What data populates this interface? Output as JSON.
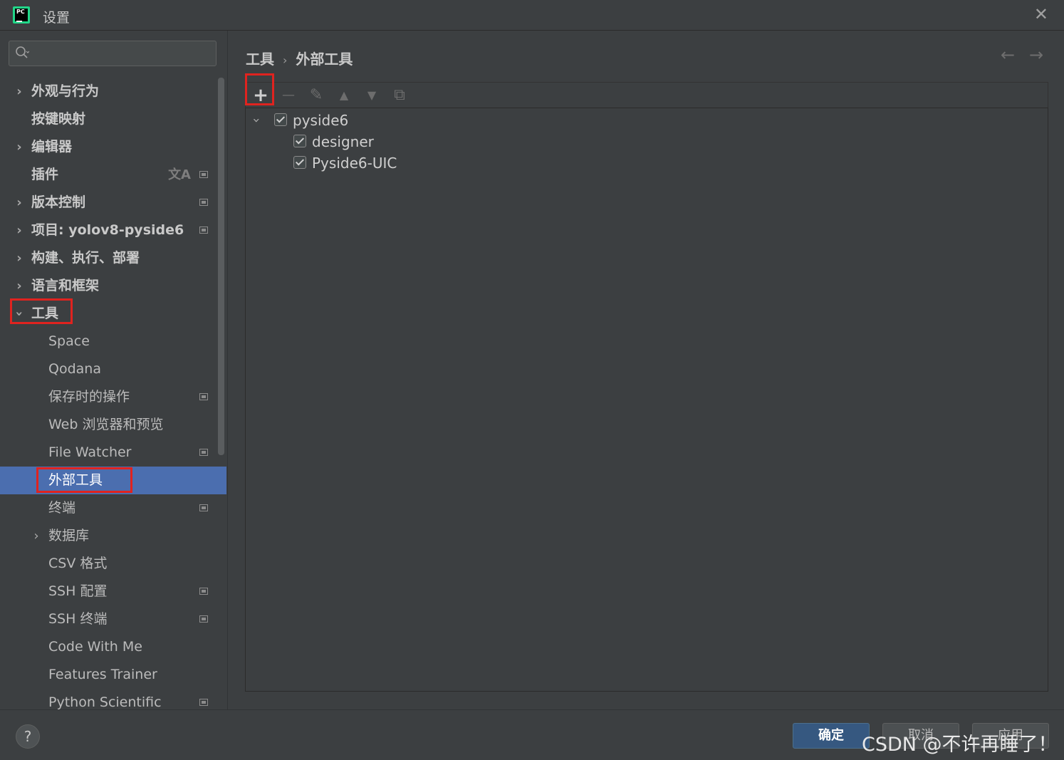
{
  "window": {
    "title": "设置",
    "app_icon": "pycharm-icon",
    "close_icon": "close-icon"
  },
  "search": {
    "placeholder": "",
    "icon": "search-icon"
  },
  "sidebar": {
    "items": [
      {
        "label": "外观与行为",
        "expandable": true,
        "bold": true,
        "expanded": false
      },
      {
        "label": "按键映射",
        "expandable": false,
        "bold": true
      },
      {
        "label": "编辑器",
        "expandable": true,
        "bold": true,
        "expanded": false
      },
      {
        "label": "插件",
        "expandable": false,
        "bold": true,
        "icons": [
          "translate-icon",
          "project-icon"
        ]
      },
      {
        "label": "版本控制",
        "expandable": true,
        "bold": true,
        "expanded": false,
        "icons": [
          "project-icon"
        ]
      },
      {
        "label": "项目: yolov8-pyside6",
        "expandable": true,
        "bold": true,
        "expanded": false,
        "icons": [
          "project-icon"
        ]
      },
      {
        "label": "构建、执行、部署",
        "expandable": true,
        "bold": true,
        "expanded": false
      },
      {
        "label": "语言和框架",
        "expandable": true,
        "bold": true,
        "expanded": false
      },
      {
        "label": "工具",
        "expandable": true,
        "bold": true,
        "expanded": true
      },
      {
        "label": "Space"
      },
      {
        "label": "Qodana"
      },
      {
        "label": "保存时的操作",
        "icons": [
          "project-icon"
        ]
      },
      {
        "label": "Web 浏览器和预览"
      },
      {
        "label": "File Watcher",
        "icons": [
          "project-icon"
        ]
      },
      {
        "label": "外部工具",
        "selected": true
      },
      {
        "label": "终端",
        "icons": [
          "project-icon"
        ]
      },
      {
        "label": "数据库",
        "expandable": true,
        "expanded": false
      },
      {
        "label": "CSV 格式"
      },
      {
        "label": "SSH 配置",
        "icons": [
          "project-icon"
        ]
      },
      {
        "label": "SSH 终端",
        "icons": [
          "project-icon"
        ]
      },
      {
        "label": "Code With Me"
      },
      {
        "label": "Features Trainer"
      },
      {
        "label": "Python Scientific",
        "icons": [
          "project-icon"
        ]
      }
    ]
  },
  "breadcrumb": {
    "parent": "工具",
    "separator": "›",
    "current": "外部工具"
  },
  "toolbar": {
    "add": "+",
    "remove": "—",
    "edit": "✎",
    "move_up": "▲",
    "move_down": "▼",
    "copy": "⧉"
  },
  "tree": [
    {
      "label": "pyside6",
      "checked": true,
      "expanded": true,
      "level": 0
    },
    {
      "label": "designer",
      "checked": true,
      "level": 1
    },
    {
      "label": "Pyside6-UIC",
      "checked": true,
      "level": 1
    }
  ],
  "footer": {
    "help": "?",
    "ok": "确定",
    "cancel": "取消",
    "apply": "应用",
    "watermark": "CSDN @不许再睡了！"
  },
  "colors": {
    "accent": "#4b6eaf",
    "highlight_box": "#e0231f",
    "background": "#3c3f41"
  }
}
